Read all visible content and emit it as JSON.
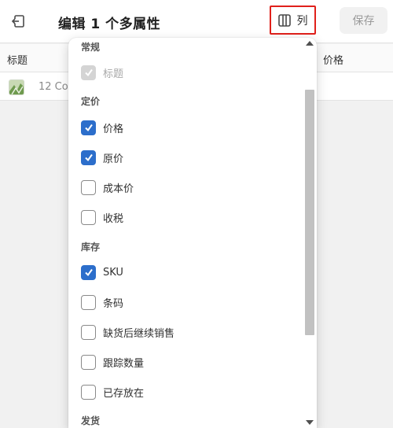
{
  "header": {
    "title": "编辑 1 个多属性",
    "columns_label": "列",
    "save_label": "保存"
  },
  "table": {
    "col_title": "标题",
    "col_price": "价格",
    "row_text": "12 Co"
  },
  "panel": {
    "sections": {
      "general": "常规",
      "pricing": "定价",
      "inventory": "库存",
      "shipping": "发货"
    },
    "options": {
      "title": {
        "label": "标题",
        "checked": true,
        "disabled": true
      },
      "price": {
        "label": "价格",
        "checked": true
      },
      "compare_price": {
        "label": "原价",
        "checked": true
      },
      "cost": {
        "label": "成本价",
        "checked": false
      },
      "tax": {
        "label": "收税",
        "checked": false
      },
      "sku": {
        "label": "SKU",
        "checked": true
      },
      "barcode": {
        "label": "条码",
        "checked": false
      },
      "continue_selling": {
        "label": "缺货后继续销售",
        "checked": false
      },
      "track_quantity": {
        "label": "跟踪数量",
        "checked": false
      },
      "stocked": {
        "label": "已存放在",
        "checked": false
      }
    }
  },
  "colors": {
    "accent": "#2c6ecb",
    "highlight_border": "#e0201b"
  }
}
